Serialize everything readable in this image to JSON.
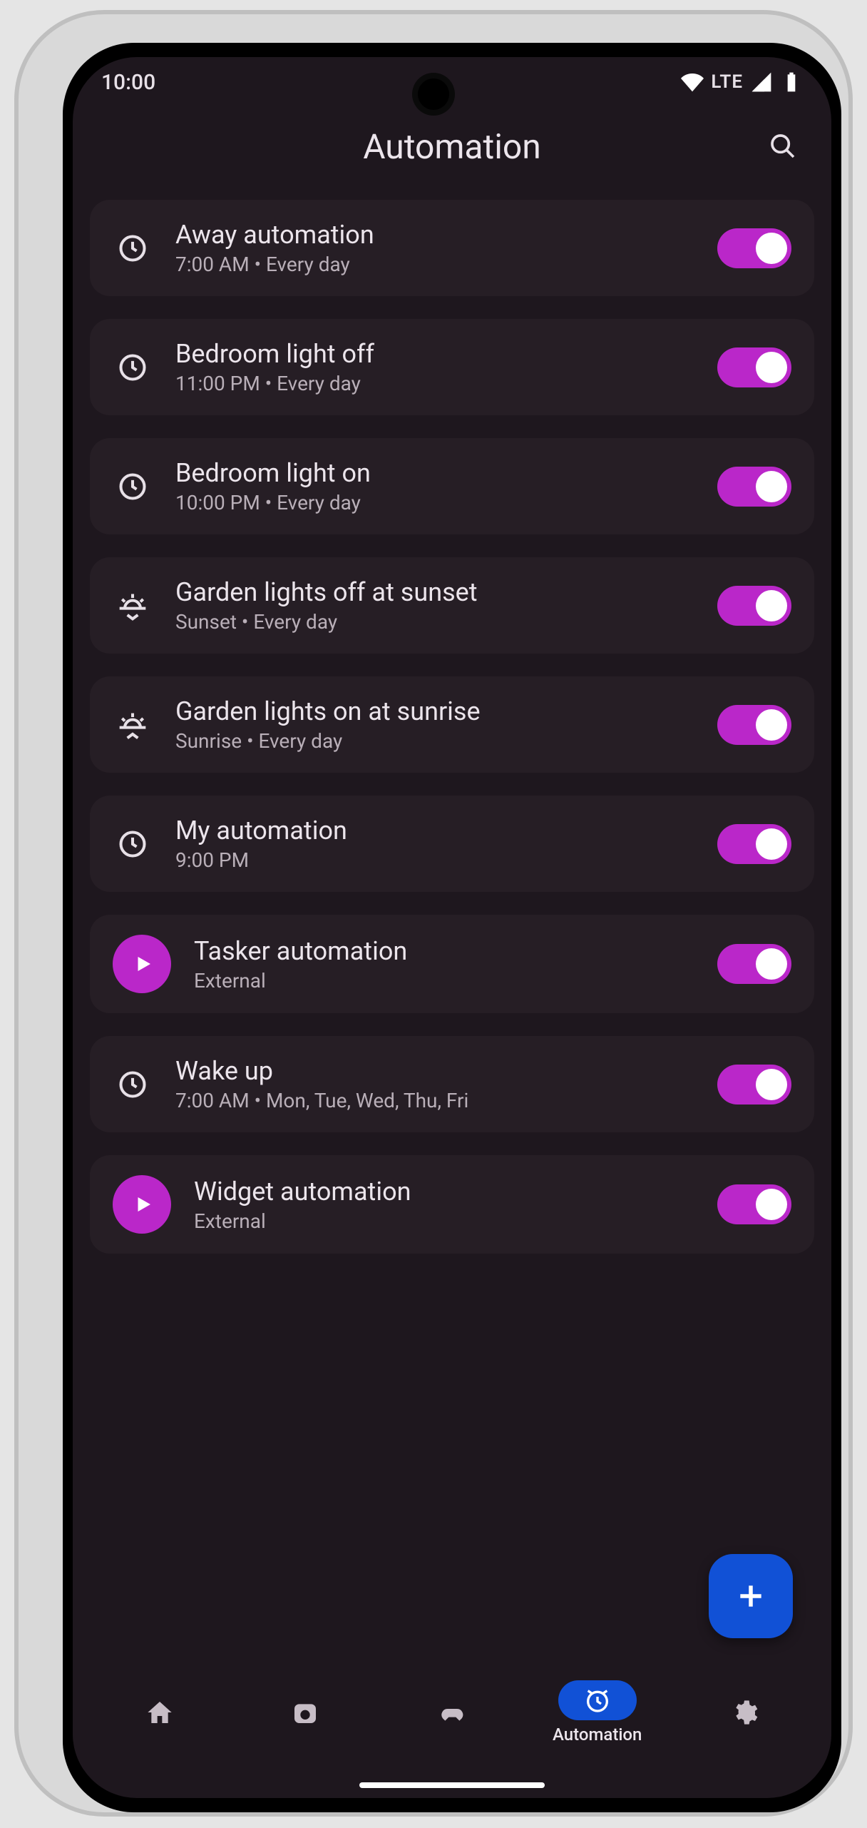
{
  "status": {
    "time": "10:00",
    "network": "LTE"
  },
  "header": {
    "title": "Automation"
  },
  "automations": [
    {
      "icon": "clock",
      "title": "Away automation",
      "sub": "7:00 AM • Every day",
      "on": true
    },
    {
      "icon": "clock",
      "title": "Bedroom light off",
      "sub": "11:00 PM • Every day",
      "on": true
    },
    {
      "icon": "clock",
      "title": "Bedroom light on",
      "sub": "10:00 PM • Every day",
      "on": true
    },
    {
      "icon": "sunset",
      "title": "Garden lights off at sunset",
      "sub": "Sunset • Every day",
      "on": true
    },
    {
      "icon": "sunrise",
      "title": "Garden lights on at sunrise",
      "sub": "Sunrise • Every day",
      "on": true
    },
    {
      "icon": "clock",
      "title": "My automation",
      "sub": "9:00 PM",
      "on": true
    },
    {
      "icon": "play",
      "title": "Tasker automation",
      "sub": "External",
      "on": true
    },
    {
      "icon": "clock",
      "title": "Wake up",
      "sub": "7:00 AM • Mon, Tue, Wed, Thu, Fri",
      "on": true
    },
    {
      "icon": "play",
      "title": "Widget automation",
      "sub": "External",
      "on": true
    }
  ],
  "nav": {
    "items": [
      {
        "icon": "home",
        "label": ""
      },
      {
        "icon": "camera",
        "label": ""
      },
      {
        "icon": "game",
        "label": ""
      },
      {
        "icon": "alarm",
        "label": "Automation",
        "active": true
      },
      {
        "icon": "gear",
        "label": ""
      }
    ]
  }
}
